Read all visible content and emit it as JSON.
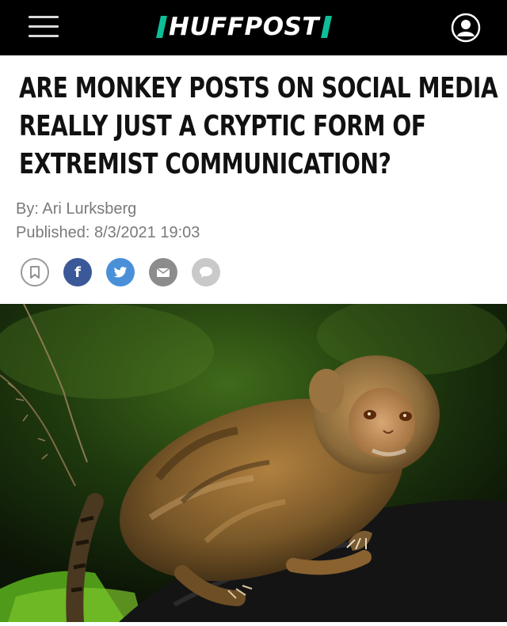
{
  "header": {
    "logo_text": "HUFFPOST",
    "menu_icon": "hamburger-menu-icon",
    "account_icon": "user-account-icon",
    "accent_color": "#0dbe98",
    "background_color": "#000000"
  },
  "article": {
    "headline_lines": [
      "ARE MONKEY POSTS ON SOCIAL MEDIA",
      "REALLY JUST A CRYPTIC FORM OF",
      "EXTREMIST COMMUNICATION?"
    ],
    "byline": "By: Ari Lurksberg",
    "published": "Published: 8/3/2021 19:03"
  },
  "share_buttons": [
    {
      "icon": "bookmark-icon",
      "color": "#9a9a9a"
    },
    {
      "icon": "facebook-icon",
      "color": "#3b5998"
    },
    {
      "icon": "twitter-icon",
      "color": "#4a90d9"
    },
    {
      "icon": "email-icon",
      "color": "#8c8c8c"
    },
    {
      "icon": "comment-icon",
      "color": "#c9c9c9"
    }
  ],
  "hero_image": {
    "subject": "pygmy-marmoset-photo"
  }
}
